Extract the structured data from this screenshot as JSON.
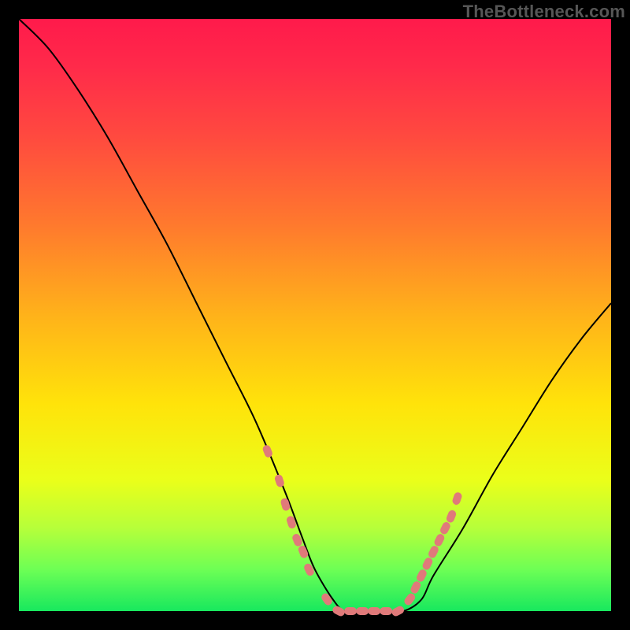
{
  "watermark": "TheBottleneck.com",
  "chart_data": {
    "type": "line",
    "title": "",
    "xlabel": "",
    "ylabel": "",
    "xlim": [
      0,
      100
    ],
    "ylim": [
      0,
      100
    ],
    "grid": false,
    "legend": false,
    "series": [
      {
        "name": "bottleneck-curve",
        "x": [
          0,
          5,
          10,
          15,
          20,
          25,
          30,
          35,
          40,
          45,
          48,
          50,
          53,
          55,
          58,
          60,
          62,
          65,
          68,
          70,
          75,
          80,
          85,
          90,
          95,
          100
        ],
        "y": [
          100,
          95,
          88,
          80,
          71,
          62,
          52,
          42,
          32,
          20,
          12,
          7,
          2,
          0,
          0,
          0,
          0,
          0,
          2,
          6,
          14,
          23,
          31,
          39,
          46,
          52
        ]
      }
    ],
    "highlight_points": {
      "name": "transition-markers",
      "x": [
        42,
        44,
        45,
        46,
        47,
        48,
        49,
        52,
        54,
        56,
        58,
        60,
        62,
        64,
        66,
        67,
        68,
        69,
        70,
        71,
        72,
        73,
        74
      ],
      "y": [
        27,
        22,
        18,
        15,
        12,
        10,
        7,
        2,
        0,
        0,
        0,
        0,
        0,
        0,
        2,
        4,
        6,
        8,
        10,
        12,
        14,
        16,
        19
      ]
    },
    "colors": {
      "curve": "#000000",
      "dots": "#e07a7a",
      "gradient_top": "#ff1a4b",
      "gradient_bottom": "#18e85e"
    }
  }
}
